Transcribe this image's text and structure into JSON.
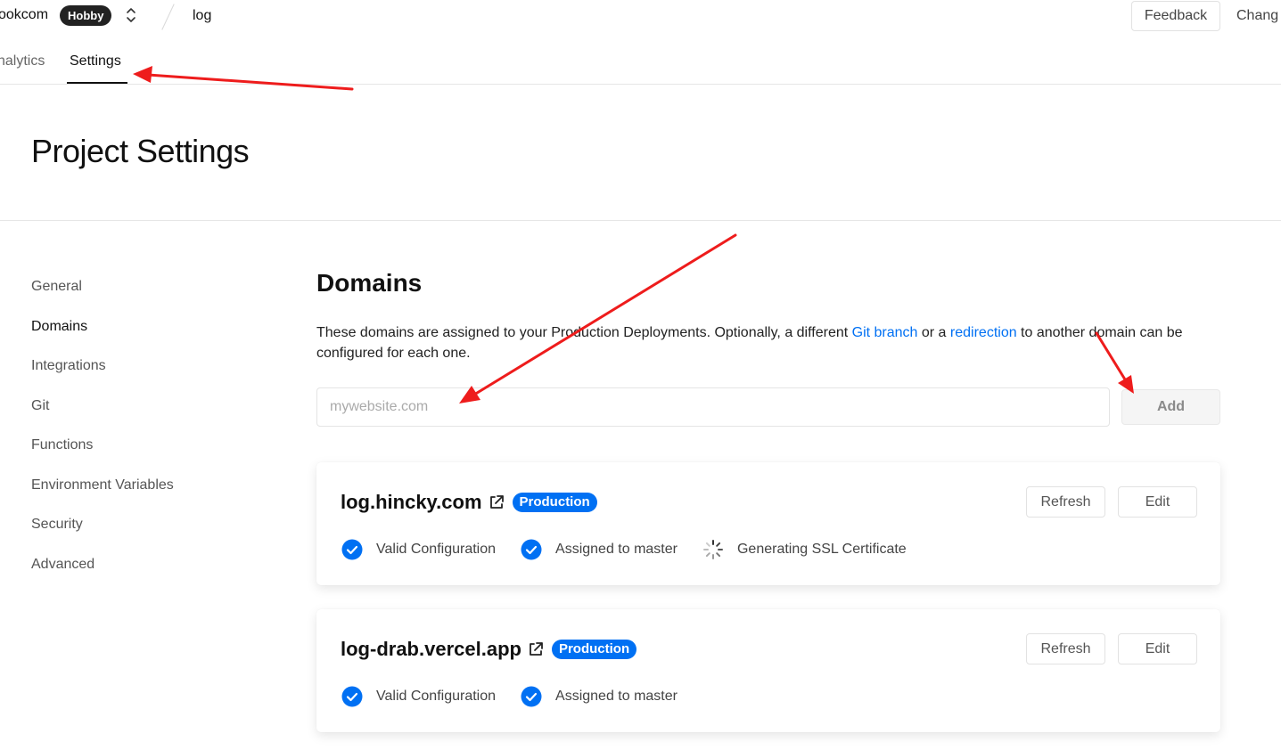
{
  "header": {
    "team_name": "ookcom",
    "plan_badge": "Hobby",
    "project_name": "log",
    "feedback_label": "Feedback",
    "changelog_label": "Chang"
  },
  "subnav": {
    "tabs": [
      {
        "label": "nalytics"
      },
      {
        "label": "Settings",
        "active": true
      }
    ]
  },
  "page": {
    "title": "Project Settings"
  },
  "sidebar": {
    "items": [
      {
        "label": "General"
      },
      {
        "label": "Domains",
        "active": true
      },
      {
        "label": "Integrations"
      },
      {
        "label": "Git"
      },
      {
        "label": "Functions"
      },
      {
        "label": "Environment Variables"
      },
      {
        "label": "Security"
      },
      {
        "label": "Advanced"
      }
    ]
  },
  "domains": {
    "title": "Domains",
    "desc_part1": "These domains are assigned to your Production Deployments. Optionally, a different ",
    "git_branch_link": "Git branch",
    "desc_part2": " or a ",
    "redirection_link": "redirection",
    "desc_part3": " to another domain can be configured for each one.",
    "input_placeholder": "mywebsite.com",
    "add_label": "Add",
    "list": [
      {
        "name": "log.hincky.com",
        "badge": "Production",
        "refresh_label": "Refresh",
        "edit_label": "Edit",
        "statuses": [
          {
            "label": "Valid Configuration",
            "icon": "check-circle-icon"
          },
          {
            "label": "Assigned to master",
            "icon": "check-circle-icon"
          },
          {
            "label": "Generating SSL Certificate",
            "icon": "spinner-icon"
          }
        ]
      },
      {
        "name": "log-drab.vercel.app",
        "badge": "Production",
        "refresh_label": "Refresh",
        "edit_label": "Edit",
        "statuses": [
          {
            "label": "Valid Configuration",
            "icon": "check-circle-icon"
          },
          {
            "label": "Assigned to master",
            "icon": "check-circle-icon"
          }
        ]
      }
    ]
  },
  "colors": {
    "accent": "#0070f3",
    "annotation_arrow": "#ee1c1c",
    "badge_dark": "#222222"
  }
}
